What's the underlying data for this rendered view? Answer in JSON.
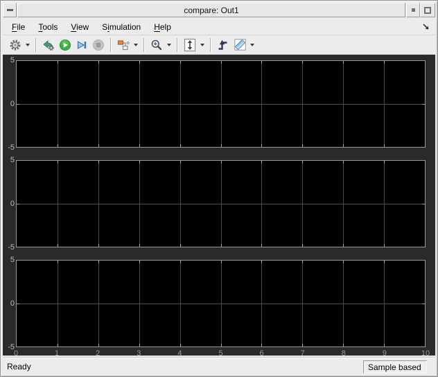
{
  "window": {
    "title": "compare: Out1"
  },
  "menubar": {
    "items": [
      {
        "label": "File",
        "accel_index": 0
      },
      {
        "label": "Tools",
        "accel_index": 0
      },
      {
        "label": "View",
        "accel_index": 0
      },
      {
        "label": "Simulation",
        "accel_index": 1
      },
      {
        "label": "Help",
        "accel_index": 0
      }
    ]
  },
  "toolbar": {
    "icons": [
      "gear-icon",
      "highlight-simulink-block-icon",
      "run-icon",
      "step-forward-icon",
      "stop-icon",
      "signal-selector-icon",
      "zoom-icon",
      "fit-to-view-icon",
      "trigger-icon",
      "cursor-measurements-icon"
    ],
    "colors": {
      "run_green": "#3cb044",
      "step_blue": "#3c78b4",
      "selector_orange": "#e8883a",
      "trigger_navy": "#33335e",
      "ruler_blue": "#bfe0f2"
    }
  },
  "statusbar": {
    "left": "Ready",
    "right": "Sample based"
  },
  "chart_data": {
    "type": "line",
    "title": "",
    "xlabel": "",
    "ylabel": "",
    "xlim": [
      0,
      10
    ],
    "x_ticks": [
      0,
      1,
      2,
      3,
      4,
      5,
      6,
      7,
      8,
      9,
      10
    ],
    "grid": true,
    "legend": "none",
    "plot_bg": "#000000",
    "panel_bg": "#2a2a2a",
    "grid_color": "#4a4a4a",
    "subplots": [
      {
        "ylim": [
          -5,
          5
        ],
        "y_ticks": [
          5,
          0,
          -5
        ],
        "series": []
      },
      {
        "ylim": [
          -5,
          5
        ],
        "y_ticks": [
          5,
          0,
          -5
        ],
        "series": []
      },
      {
        "ylim": [
          -5,
          5
        ],
        "y_ticks": [
          5,
          0,
          -5
        ],
        "series": []
      }
    ]
  }
}
